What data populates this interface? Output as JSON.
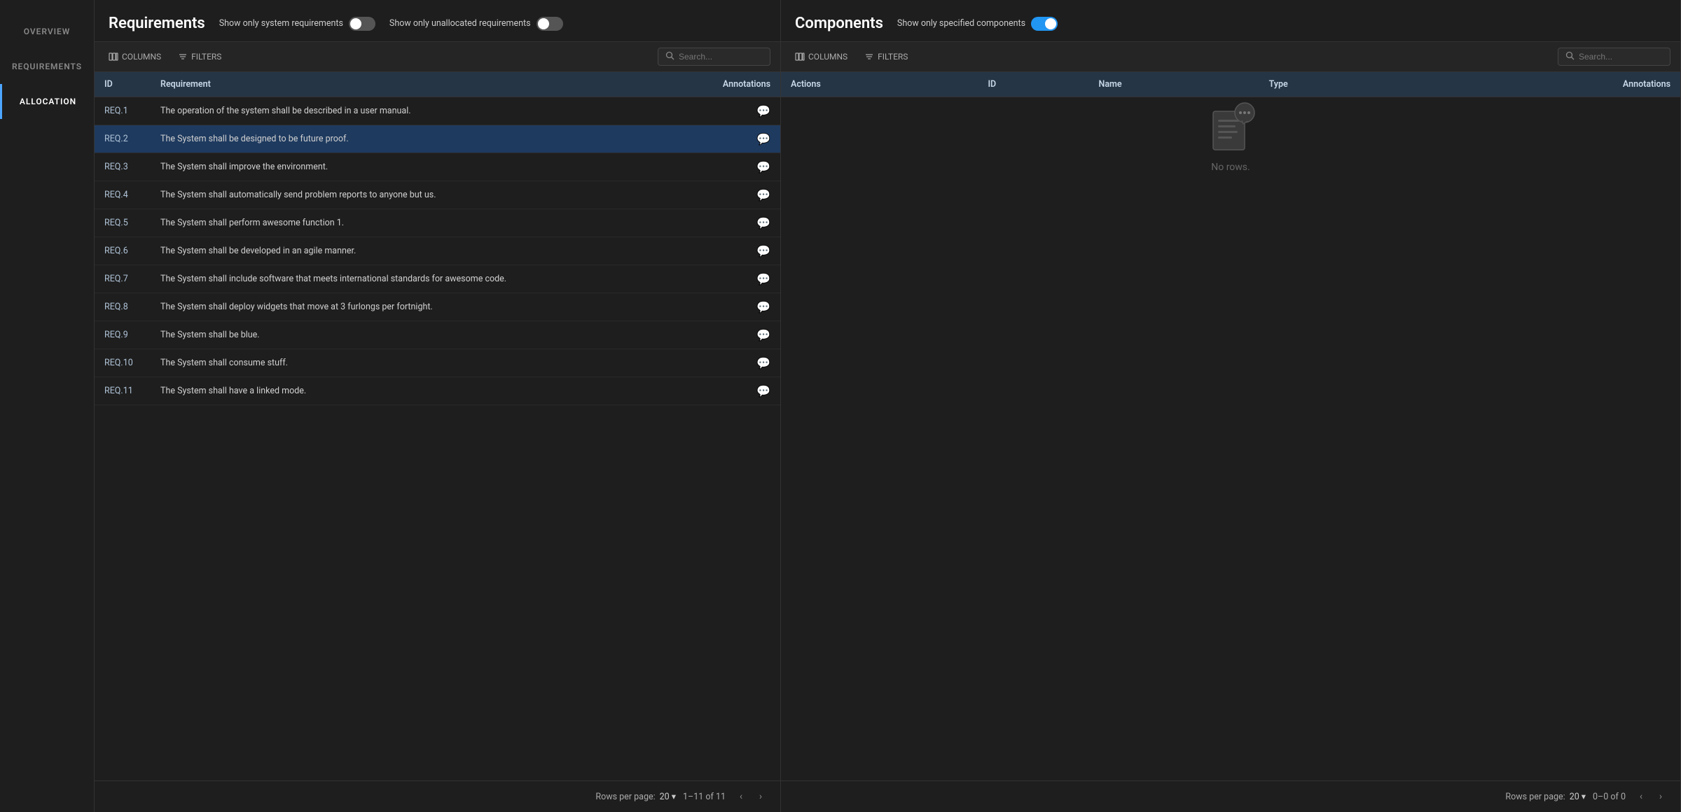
{
  "sidebar": {
    "items": [
      {
        "label": "OVERVIEW",
        "active": false
      },
      {
        "label": "REQUIREMENTS",
        "active": false
      },
      {
        "label": "ALLOCATION",
        "active": true
      }
    ]
  },
  "requirements_panel": {
    "title": "Requirements",
    "toggle1_label": "Show only system requirements",
    "toggle1_on": false,
    "toggle2_label": "Show only unallocated requirements",
    "toggle2_on": false,
    "columns_label": "COLUMNS",
    "filters_label": "FILTERS",
    "search_placeholder": "Search...",
    "columns": [
      {
        "key": "id",
        "label": "ID"
      },
      {
        "key": "requirement",
        "label": "Requirement"
      },
      {
        "key": "annotations",
        "label": "Annotations"
      }
    ],
    "rows": [
      {
        "id": "REQ.1",
        "requirement": "The operation of the system shall be described in a user manual.",
        "selected": false
      },
      {
        "id": "REQ.2",
        "requirement": "The System shall be designed to be future proof.",
        "selected": true
      },
      {
        "id": "REQ.3",
        "requirement": "The System shall improve the environment.",
        "selected": false
      },
      {
        "id": "REQ.4",
        "requirement": "The System shall automatically send problem reports to anyone but us.",
        "selected": false
      },
      {
        "id": "REQ.5",
        "requirement": "The System shall perform awesome function 1.",
        "selected": false
      },
      {
        "id": "REQ.6",
        "requirement": "The System shall be developed in an agile manner.",
        "selected": false
      },
      {
        "id": "REQ.7",
        "requirement": "The System shall include software that meets international standards for awesome code.",
        "selected": false
      },
      {
        "id": "REQ.8",
        "requirement": "The System shall deploy widgets that move at 3 furlongs per fortnight.",
        "selected": false
      },
      {
        "id": "REQ.9",
        "requirement": "The System shall be blue.",
        "selected": false
      },
      {
        "id": "REQ.10",
        "requirement": "The System shall consume stuff.",
        "selected": false
      },
      {
        "id": "REQ.11",
        "requirement": "The System shall have a linked mode.",
        "selected": false
      }
    ],
    "pagination": {
      "rows_per_page_label": "Rows per page:",
      "rows_per_page_value": "20",
      "page_info": "1–11 of 11"
    }
  },
  "components_panel": {
    "title": "Components",
    "toggle_label": "Show only specified components",
    "toggle_on": true,
    "columns_label": "COLUMNS",
    "filters_label": "FILTERS",
    "search_placeholder": "Search...",
    "columns": [
      {
        "key": "actions",
        "label": "Actions"
      },
      {
        "key": "id",
        "label": "ID"
      },
      {
        "key": "name",
        "label": "Name"
      },
      {
        "key": "type",
        "label": "Type"
      },
      {
        "key": "annotations",
        "label": "Annotations"
      }
    ],
    "no_rows_text": "No rows.",
    "pagination": {
      "rows_per_page_label": "Rows per page:",
      "rows_per_page_value": "20",
      "page_info": "0–0 of 0"
    }
  }
}
